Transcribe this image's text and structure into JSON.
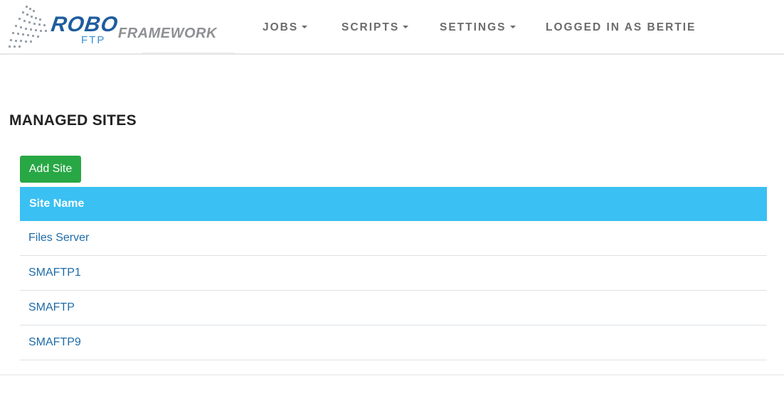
{
  "brand": {
    "robo": "ROBO",
    "ftp": "FTP",
    "framework": "FRAMEWORK"
  },
  "nav": {
    "jobs": "JOBS",
    "scripts": "SCRIPTS",
    "settings": "SETTINGS",
    "user": "LOGGED IN AS BERTIE"
  },
  "page": {
    "title": "MANAGED SITES",
    "add_button": "Add Site"
  },
  "table": {
    "header": "Site Name",
    "rows": [
      "Files Server",
      "SMAFTP1",
      "SMAFTP",
      "SMAFTP9"
    ]
  },
  "colors": {
    "add_button": "#28a745",
    "table_header": "#3ac0f2",
    "link": "#1e6ba8",
    "brand_blue": "#1f5c9e"
  }
}
